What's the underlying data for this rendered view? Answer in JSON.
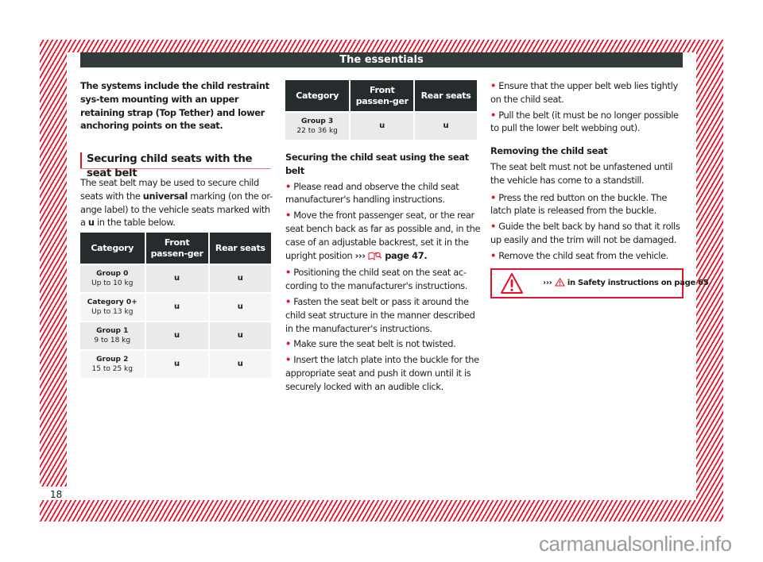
{
  "header": {
    "title": "The essentials"
  },
  "page_number": "18",
  "left_column": {
    "intro": "The systems include the child restraint sys-tem mounting with an upper retaining strap (Top Tether) and lower anchoring points on the seat.",
    "section_heading": "Securing child seats with the seat belt",
    "body_pre": "The seat belt may be used to secure child seats with the ",
    "body_bold": "universal",
    "body_mid": " marking (on the or-ange label) to the vehicle seats marked with a ",
    "body_bold2": "u",
    "body_post": " in the table below.",
    "table": {
      "headers": [
        "Category",
        "Front passen-ger",
        "Rear seats"
      ],
      "rows": [
        {
          "category": "Group 0",
          "weight": "Up to 10 kg",
          "front": "u",
          "rear": "u"
        },
        {
          "category": "Category 0+",
          "weight": "Up to 13 kg",
          "front": "u",
          "rear": "u"
        },
        {
          "category": "Group 1",
          "weight": "9 to 18 kg",
          "front": "u",
          "rear": "u"
        },
        {
          "category": "Group 2",
          "weight": "15 to 25 kg",
          "front": "u",
          "rear": "u"
        }
      ]
    }
  },
  "middle_column": {
    "table": {
      "headers": [
        "Category",
        "Front passen-ger",
        "Rear seats"
      ],
      "rows": [
        {
          "category": "Group 3",
          "weight": "22 to 36 kg",
          "front": "u",
          "rear": "u"
        }
      ]
    },
    "subheading": "Securing the child seat using the seat belt",
    "bullets": [
      "Please read and observe the child seat manufacturer's handling instructions.",
      "Move the front passenger seat, or the rear seat bench back as far as possible and, in the case of an adjustable backrest, set it in the upright position",
      "Positioning the child seat on the seat ac-cording to the manufacturer's instructions.",
      "Fasten the seat belt or pass it around the child seat structure in the manner described in the manufacturer's instructions.",
      "Make sure the seat belt is not twisted.",
      "Insert the latch plate into the buckle for the appropriate seat and push it down until it is securely locked with an audible click."
    ],
    "ref_arrows": "›››",
    "ref_icon": "book-search-icon",
    "ref_page": "page 47."
  },
  "right_column": {
    "bullets_top": [
      "Ensure that the upper belt web lies tightly on the child seat.",
      "Pull the belt (it must be no longer possible to pull the lower belt webbing out)."
    ],
    "subheading": "Removing the child seat",
    "body": "The seat belt must not be unfastened until the vehicle has come to a standstill.",
    "bullets_bottom": [
      "Press the red button on the buckle. The latch plate is released from the buckle.",
      "Guide the belt back by hand so that it rolls up easily and the trim will not be damaged.",
      "Remove the child seat from the vehicle."
    ],
    "warning": {
      "icon": "warning-triangle-icon",
      "arrows": "›››",
      "text": " in Safety instructions on page 65"
    }
  },
  "colors": {
    "accent": "#e5122a",
    "header_bg": "#333a3c",
    "table_header_bg": "#262b2d",
    "row_odd": "#e8eaeb",
    "row_even": "#f4f6f6"
  },
  "watermark": "carmanualsonline.info"
}
